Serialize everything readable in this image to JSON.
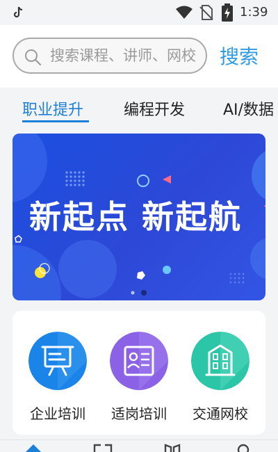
{
  "status_bar": {
    "time": "1:39",
    "icons": [
      "tiktok-icon",
      "wifi-icon",
      "no-sim-icon",
      "battery-icon"
    ]
  },
  "search": {
    "placeholder": "搜索课程、讲师、网校",
    "button_label": "搜索"
  },
  "tabs": [
    {
      "label": "职业提升",
      "active": true
    },
    {
      "label": "编程开发",
      "active": false
    },
    {
      "label": "AI/数据",
      "active": false
    }
  ],
  "banner": {
    "text": "新起点 新起航",
    "page_count": 2,
    "current_page": 2
  },
  "quick_entries": [
    {
      "label": "企业培训",
      "icon": "presentation-board-icon"
    },
    {
      "label": "适岗培训",
      "icon": "certificate-icon"
    },
    {
      "label": "交通网校",
      "icon": "building-icon"
    }
  ],
  "bottom_nav": {
    "icons": [
      "home-icon",
      "courses-icon",
      "books-icon",
      "profile-icon"
    ]
  },
  "colors": {
    "accent": "#1c7fd9",
    "search_button": "#2f9be6",
    "banner_blue": "#2d48d6",
    "entry_blue": "#1a84e8",
    "entry_purple": "#8b62e6",
    "entry_teal": "#2bc6a8"
  }
}
